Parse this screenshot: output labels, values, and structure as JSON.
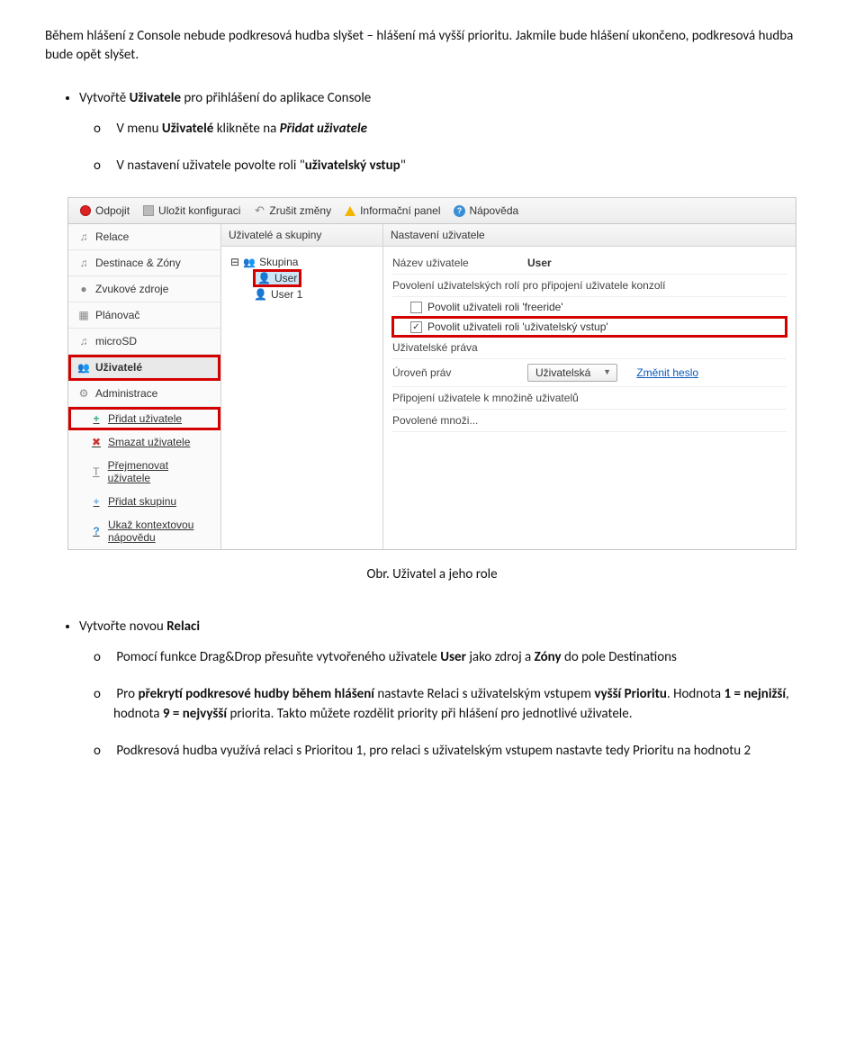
{
  "intro": {
    "para1": "Během hlášení z Console nebude podkresová hudba slyšet – hlášení má vyšší prioritu. Jakmile bude hlášení ukončeno, podkresová hudba bude opět slyšet."
  },
  "bullet1": {
    "text_a": "Vytvořtě ",
    "text_b": "Uživatele",
    "text_c": " pro přihlášení do aplikace Console"
  },
  "bullet1_sub1": {
    "a": "V menu ",
    "b": "Uživatelé",
    "c": " klikněte na ",
    "d": "Přidat uživatele"
  },
  "bullet1_sub2": {
    "a": "V nastavení uživatele povolte roli \"",
    "b": "uživatelský vstup",
    "c": "\""
  },
  "caption1": "Obr. Uživatel a jeho role",
  "bullet2": {
    "a": "Vytvořte novou ",
    "b": "Relaci"
  },
  "bullet2_sub1": {
    "a": "Pomocí funkce Drag&Drop přesuňte vytvořeného uživatele ",
    "b": "User",
    "c": " jako zdroj a ",
    "d": "Zóny",
    "e": " do pole Destinations"
  },
  "bullet2_sub2": {
    "a": "Pro ",
    "b": "překrytí podkresové hudby během hlášení",
    "c": " nastavte Relaci s uživatelským vstupem ",
    "d": "vyšší Prioritu",
    "e": ". Hodnota ",
    "f": "1 = nejnižší",
    "g": ", hodnota ",
    "h": "9 = nejvyšší",
    "i": " priorita. Takto můžete rozdělit priority při hlášení pro jednotlivé uživatele."
  },
  "bullet2_sub3": {
    "a": "Podkresová hudba využívá relaci s Prioritou 1, pro relaci s uživatelským vstupem nastavte tedy Prioritu na hodnotu 2"
  },
  "app": {
    "toolbar": {
      "odpojit": "Odpojit",
      "ulozit": "Uložit konfiguraci",
      "zrusit": "Zrušit změny",
      "info": "Informační panel",
      "help": "Nápověda"
    },
    "sidebar": {
      "relace": "Relace",
      "destinace": "Destinace & Zóny",
      "zvuk": "Zvukové zdroje",
      "planovac": "Plánovač",
      "microsd": "microSD",
      "uzivatele": "Uživatelé",
      "administrace": "Administrace",
      "pridat_uziv": "Přidat uživatele",
      "smazat_uziv": "Smazat uživatele",
      "prejmenovat": "Přejmenovat uživatele",
      "pridat_skup": "Přidat skupinu",
      "ukaz_napovedu_l1": "Ukaž kontextovou",
      "ukaz_napovedu_l2": "nápovědu"
    },
    "midcol": {
      "header": "Uživatelé a skupiny",
      "skupina": "Skupina",
      "user": "User",
      "user1": "User 1"
    },
    "rightcol": {
      "header": "Nastavení uživatele",
      "nazev_lbl": "Název uživatele",
      "nazev_val": "User",
      "povoleni_lbl": "Povolení uživatelských rolí pro připojení uživatele konzolí",
      "freeride": "Povolit uživateli roli 'freeride'",
      "uvstup": "Povolit uživateli roli 'uživatelský vstup'",
      "prava_lbl": "Uživatelské práva",
      "uroven_lbl": "Úroveň práv",
      "uroven_val": "Uživatelská",
      "zmenit_heslo": "Změnit heslo",
      "pripojeni_lbl": "Připojení uživatele k množině uživatelů",
      "povolene_lbl": "Povolené množi..."
    }
  }
}
